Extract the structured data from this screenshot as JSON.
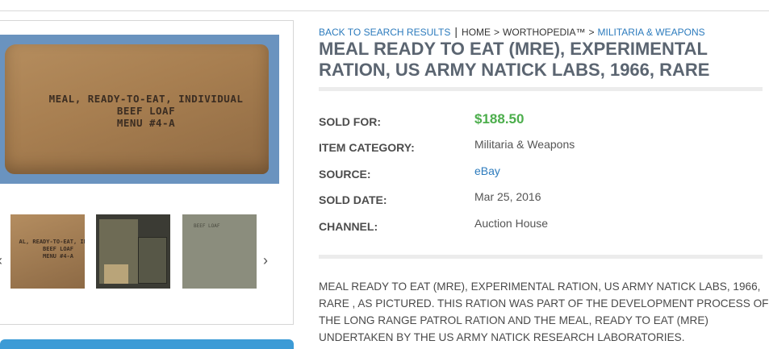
{
  "breadcrumb": {
    "back_link": "BACK TO SEARCH RESULTS",
    "separator": "|",
    "home": "HOME",
    "arrow": ">",
    "worthopedia": "WORTHOPEDIA™",
    "category": "MILITARIA & WEAPONS"
  },
  "item": {
    "title": "MEAL READY TO EAT (MRE), EXPERIMENTAL RATION, US ARMY NATICK LABS, 1966, RARE",
    "description": "MEAL READY TO EAT (MRE), EXPERIMENTAL RATION, US ARMY NATICK LABS, 1966, RARE , AS PICTURED. THIS RATION WAS PART OF THE DEVELOPMENT PROCESS OF THE LONG RANGE PATROL RATION AND THE MEAL, READY TO EAT (MRE) UNDERTAKEN BY THE US ARMY NATICK RESEARCH LABORATORIES."
  },
  "details": {
    "sold_for_label": "SOLD FOR:",
    "sold_for_value": "$188.50",
    "category_label": "ITEM CATEGORY:",
    "category_value": "Militaria & Weapons",
    "source_label": "SOURCE:",
    "source_value": "eBay",
    "sold_date_label": "SOLD DATE:",
    "sold_date_value": "Mar 25, 2016",
    "channel_label": "CHANNEL:",
    "channel_value": "Auction House"
  },
  "gallery": {
    "main_text": [
      "MEAL, READY-TO-EAT, INDIVIDUAL",
      "BEEF LOAF",
      "MENU #4-A"
    ],
    "thumb1_text": [
      "AL, READY-TO-EAT, INDIV",
      "BEEF LOAF",
      "MENU #4-A"
    ],
    "thumb3_text": [
      "BEEF LOAF"
    ],
    "prev_arrow": "‹",
    "next_arrow": "›"
  },
  "colors": {
    "link": "#2c7bbd",
    "price": "#4cae4c",
    "title": "#5b6571",
    "accent_bar": "#3c9bd6"
  }
}
